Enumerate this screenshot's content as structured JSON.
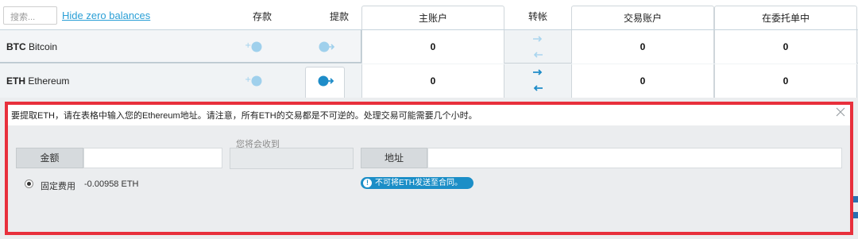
{
  "header": {
    "search_placeholder": "搜索...",
    "hide_zero_link": "Hide zero balances",
    "col_deposit": "存款",
    "col_withdraw": "提款",
    "col_main_account": "主账户",
    "col_transfer": "转帐",
    "col_trading_account": "交易账户",
    "col_orders": "在委托单中"
  },
  "assets": [
    {
      "symbol": "BTC",
      "name": "Bitcoin",
      "main": "0",
      "trading": "0",
      "in_orders": "0"
    },
    {
      "symbol": "ETH",
      "name": "Ethereum",
      "main": "0",
      "trading": "0",
      "in_orders": "0"
    }
  ],
  "withdraw": {
    "notice": "要提取ETH，请在表格中输入您的Ethereum地址。请注意，所有ETH的交易都是不可逆的。处理交易可能需要几个小时。",
    "amount_label": "金额",
    "receive_label": "您将会收到",
    "address_label": "地址",
    "fee_label": "固定费用",
    "fee_value": "-0.00958 ETH",
    "contract_warning": "不可将ETH发送至合同。"
  },
  "colors": {
    "accent": "#2a9fd6",
    "highlight_frame": "#e8303c",
    "warning_pill": "#1b8ec7",
    "icon_blue": "#1e8cc8",
    "icon_light": "#9fd0ec"
  },
  "icons": [
    "deposit-icon",
    "withdraw-icon",
    "transfer-right-arrow-icon",
    "transfer-left-arrow-icon",
    "close-icon",
    "info-icon"
  ]
}
